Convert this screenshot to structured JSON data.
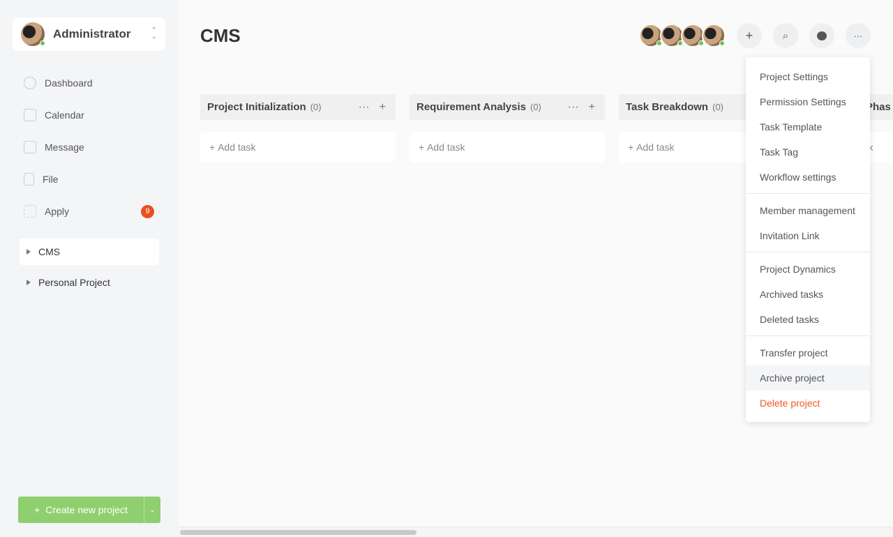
{
  "user": {
    "name": "Administrator"
  },
  "nav": [
    {
      "label": "Dashboard",
      "icon": "dashboard-icon"
    },
    {
      "label": "Calendar",
      "icon": "calendar-icon"
    },
    {
      "label": "Message",
      "icon": "message-icon"
    },
    {
      "label": "File",
      "icon": "file-icon"
    },
    {
      "label": "Apply",
      "icon": "apply-icon",
      "badge": "9"
    }
  ],
  "projects": [
    {
      "label": "CMS"
    },
    {
      "label": "Personal Project"
    }
  ],
  "create_label": "Create new project",
  "page_title": "CMS",
  "columns": [
    {
      "title": "Project Initialization",
      "count": "(0)"
    },
    {
      "title": "Requirement Analysis",
      "count": "(0)"
    },
    {
      "title": "Task Breakdown",
      "count": "(0)"
    },
    {
      "title": "Phas",
      "count": ""
    }
  ],
  "add_task": "Add task",
  "menu": {
    "groups": [
      [
        "Project Settings",
        "Permission Settings",
        "Task Template",
        "Task Tag",
        "Workflow settings"
      ],
      [
        "Member management",
        "Invitation Link"
      ],
      [
        "Project Dynamics",
        "Archived tasks",
        "Deleted tasks"
      ],
      [
        "Transfer project",
        "Archive project",
        "Delete project"
      ]
    ]
  },
  "colors": {
    "accent": "#8fcf6f",
    "danger": "#f0581e",
    "badge": "#e8501e"
  }
}
